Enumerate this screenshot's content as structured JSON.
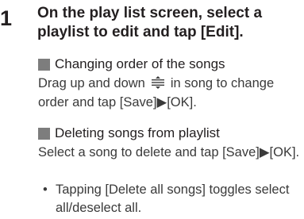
{
  "step": {
    "number": "1",
    "title": "On the play list screen, select a playlist to edit and tap [Edit]."
  },
  "sections": [
    {
      "heading": "Changing order of the songs",
      "body_before_icon": "Drag up and down",
      "body_icon": "reorder-handle-icon",
      "body_after_icon": "in song to change order and tap [Save]▶[OK]."
    },
    {
      "heading": "Deleting songs from playlist",
      "body": "Select a song to delete and tap [Save]▶[OK]."
    }
  ],
  "bullet": {
    "marker": "•",
    "text": "Tapping [Delete all songs] toggles select all/deselect all."
  },
  "colors": {
    "heading_square": "#7d7d7d",
    "text": "#231f20",
    "body_text": "#3a3a3a"
  }
}
